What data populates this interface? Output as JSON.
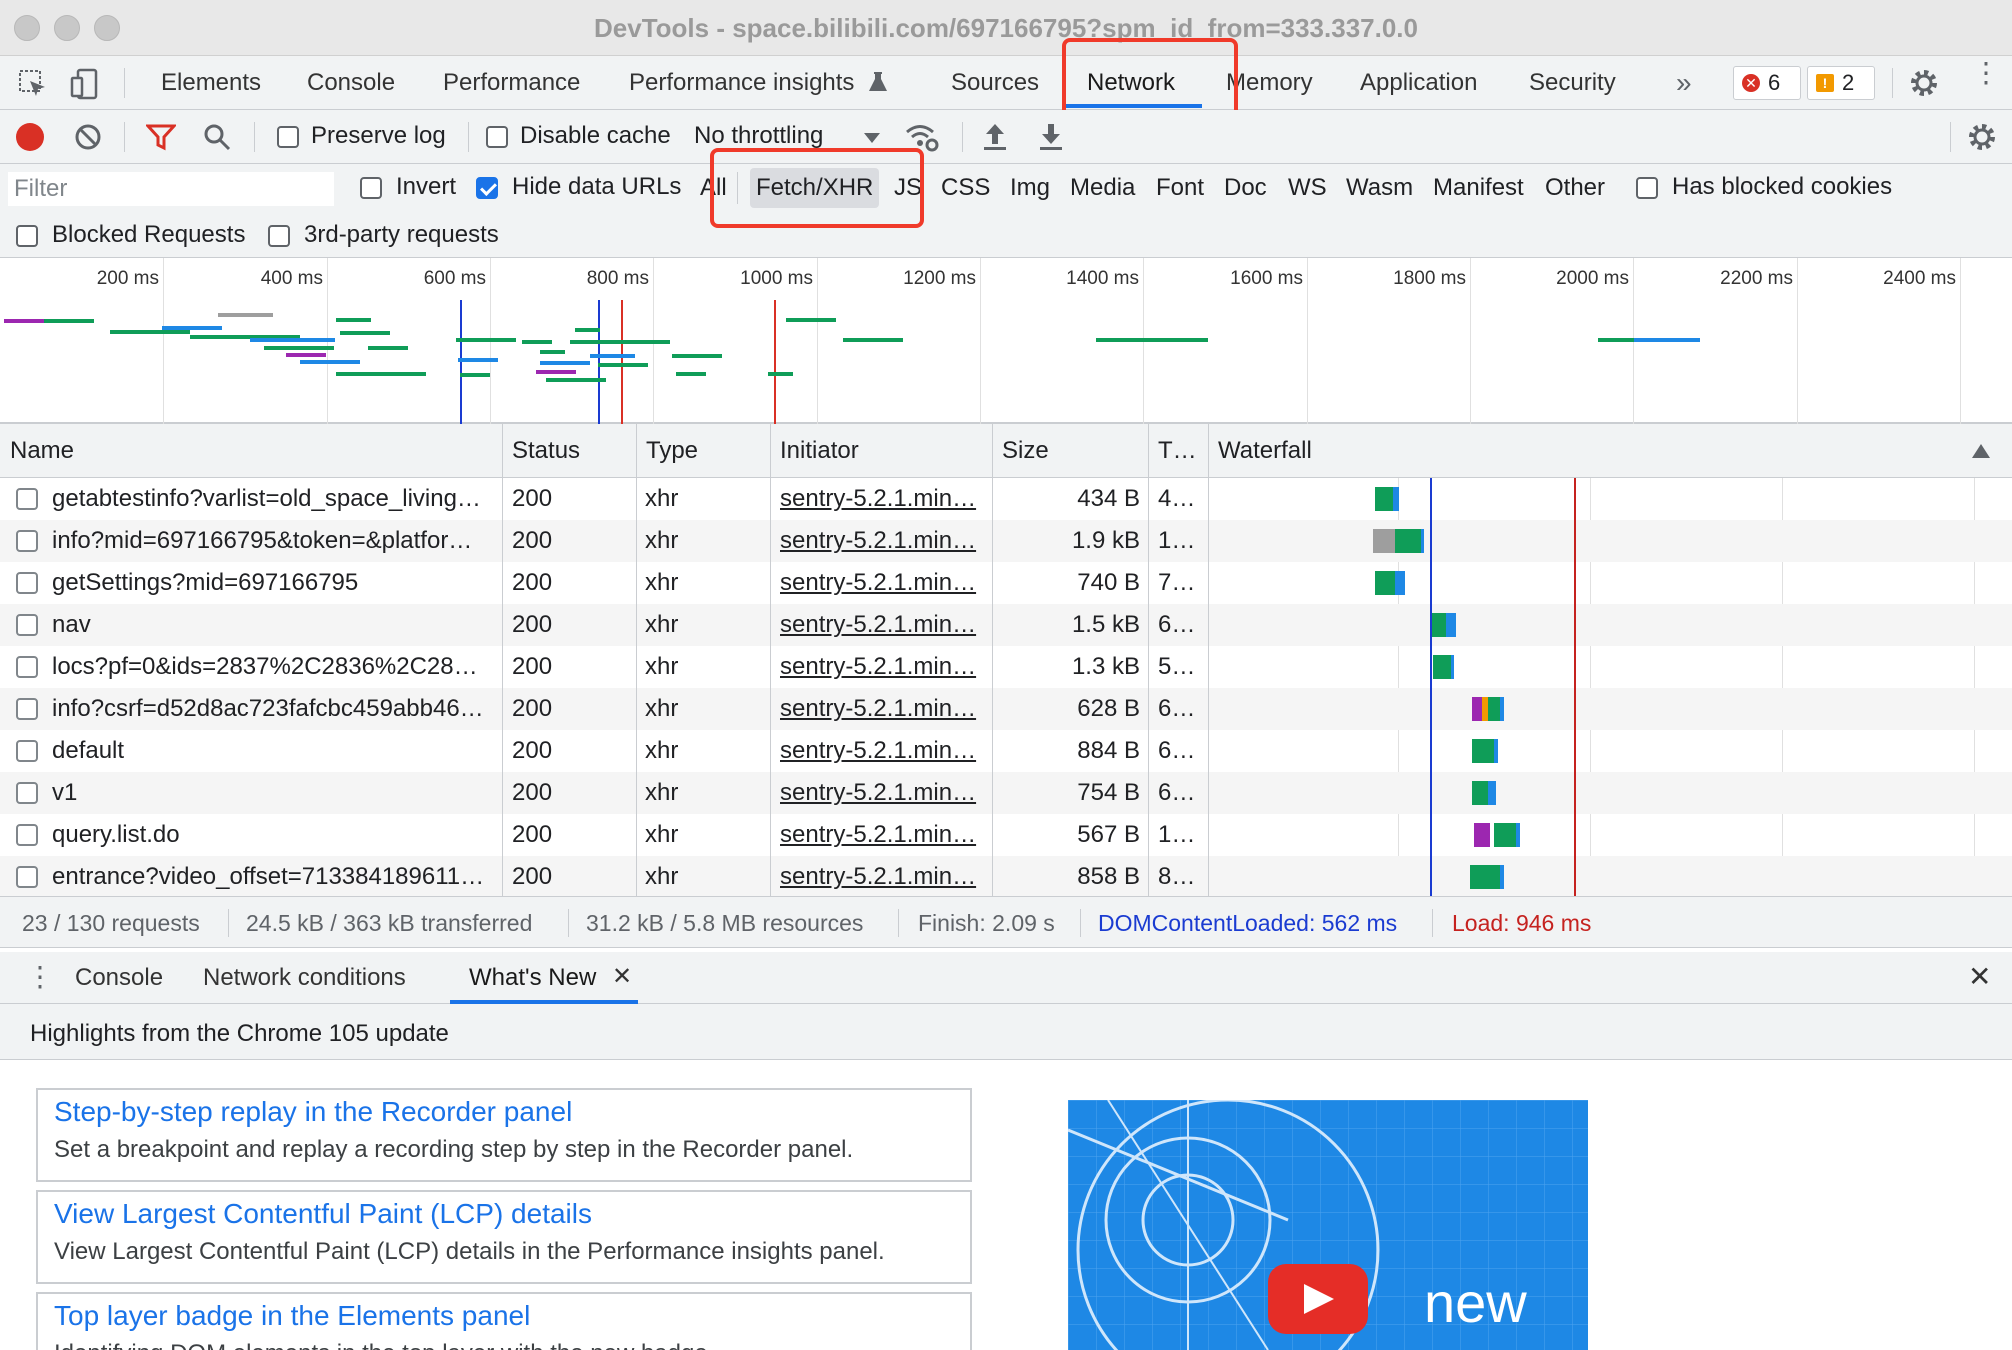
{
  "window": {
    "title": "DevTools - space.bilibili.com/697166795?spm_id_from=333.337.0.0"
  },
  "tabs": [
    {
      "label": "Elements"
    },
    {
      "label": "Console"
    },
    {
      "label": "Performance"
    },
    {
      "label": "Performance insights"
    },
    {
      "label": "Sources"
    },
    {
      "label": "Network",
      "active": true
    },
    {
      "label": "Memory"
    },
    {
      "label": "Application"
    },
    {
      "label": "Security"
    }
  ],
  "badges": {
    "errors": "6",
    "warnings": "2"
  },
  "toolbar": {
    "preserve_log": "Preserve log",
    "disable_cache": "Disable cache",
    "throttling": "No throttling"
  },
  "filter": {
    "placeholder": "Filter",
    "invert": "Invert",
    "hide_data_urls": "Hide data URLs",
    "types": [
      "All",
      "Fetch/XHR",
      "JS",
      "CSS",
      "Img",
      "Media",
      "Font",
      "Doc",
      "WS",
      "Wasm",
      "Manifest",
      "Other"
    ],
    "active_type": "Fetch/XHR",
    "has_blocked_cookies": "Has blocked cookies",
    "blocked_requests": "Blocked Requests",
    "third_party": "3rd-party requests"
  },
  "overview": {
    "ticks": [
      "200 ms",
      "400 ms",
      "600 ms",
      "800 ms",
      "1000 ms",
      "1200 ms",
      "1400 ms",
      "1600 ms",
      "1800 ms",
      "2000 ms",
      "2200 ms",
      "2400 ms"
    ]
  },
  "grid": {
    "headers": {
      "name": "Name",
      "status": "Status",
      "type": "Type",
      "initiator": "Initiator",
      "size": "Size",
      "time": "T…",
      "waterfall": "Waterfall"
    },
    "rows": [
      {
        "name": "getabtestinfo?varlist=old_space_living…",
        "status": "200",
        "type": "xhr",
        "initiator": "sentry-5.2.1.min…",
        "size": "434 B",
        "time": "4…"
      },
      {
        "name": "info?mid=697166795&token=&platfor…",
        "status": "200",
        "type": "xhr",
        "initiator": "sentry-5.2.1.min…",
        "size": "1.9 kB",
        "time": "1…"
      },
      {
        "name": "getSettings?mid=697166795",
        "status": "200",
        "type": "xhr",
        "initiator": "sentry-5.2.1.min…",
        "size": "740 B",
        "time": "7…"
      },
      {
        "name": "nav",
        "status": "200",
        "type": "xhr",
        "initiator": "sentry-5.2.1.min…",
        "size": "1.5 kB",
        "time": "6…"
      },
      {
        "name": "locs?pf=0&ids=2837%2C2836%2C28…",
        "status": "200",
        "type": "xhr",
        "initiator": "sentry-5.2.1.min…",
        "size": "1.3 kB",
        "time": "5…"
      },
      {
        "name": "info?csrf=d52d8ac723fafcbc459abb46…",
        "status": "200",
        "type": "xhr",
        "initiator": "sentry-5.2.1.min…",
        "size": "628 B",
        "time": "6…"
      },
      {
        "name": "default",
        "status": "200",
        "type": "xhr",
        "initiator": "sentry-5.2.1.min…",
        "size": "884 B",
        "time": "6…"
      },
      {
        "name": "v1",
        "status": "200",
        "type": "xhr",
        "initiator": "sentry-5.2.1.min…",
        "size": "754 B",
        "time": "6…"
      },
      {
        "name": "query.list.do",
        "status": "200",
        "type": "xhr",
        "initiator": "sentry-5.2.1.min…",
        "size": "567 B",
        "time": "1…"
      },
      {
        "name": "entrance?video_offset=713384189611…",
        "status": "200",
        "type": "xhr",
        "initiator": "sentry-5.2.1.min…",
        "size": "858 B",
        "time": "8…"
      }
    ]
  },
  "summary": {
    "requests": "23 / 130 requests",
    "transferred": "24.5 kB / 363 kB transferred",
    "resources": "31.2 kB / 5.8 MB resources",
    "finish": "Finish: 2.09 s",
    "dcl": "DOMContentLoaded: 562 ms",
    "load": "Load: 946 ms"
  },
  "colors": {
    "dcl": "#1a3bd1",
    "load": "#c5221f",
    "accent": "#1a73e8",
    "highlight": "#f03a2a"
  },
  "drawer": {
    "tabs": [
      "Console",
      "Network conditions",
      "What's New"
    ],
    "active_tab": "What's New",
    "header": "Highlights from the Chrome 105 update",
    "cards": [
      {
        "title": "Step-by-step replay in the Recorder panel",
        "desc": "Set a breakpoint and replay a recording step by step in the Recorder panel."
      },
      {
        "title": "View Largest Contentful Paint (LCP) details",
        "desc": "View Largest Contentful Paint (LCP) details in the Performance insights panel."
      },
      {
        "title": "Top layer badge in the Elements panel",
        "desc": "Identifying DOM elements in the top layer with the new badge"
      }
    ],
    "promo_text": "new"
  }
}
